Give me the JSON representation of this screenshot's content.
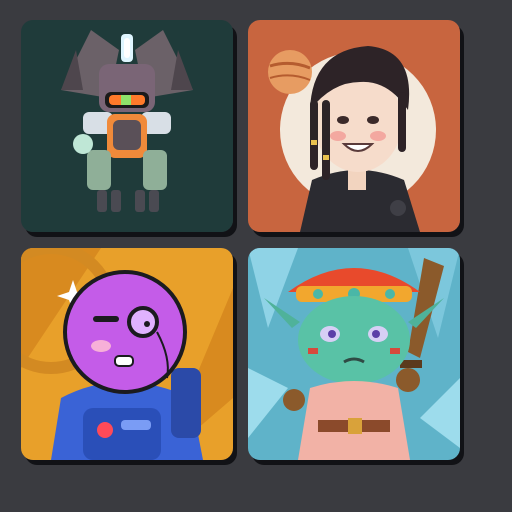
{
  "gallery": {
    "items": [
      {
        "subject": "robot-mech-avatar",
        "bg": "#1f3b3a"
      },
      {
        "subject": "dreadlocks-person-avatar",
        "bg": "#c8653f"
      },
      {
        "subject": "purple-astronaut-avatar",
        "bg": "#e8a02a"
      },
      {
        "subject": "goblin-warrior-avatar",
        "bg": "#5fb3c9"
      }
    ]
  }
}
